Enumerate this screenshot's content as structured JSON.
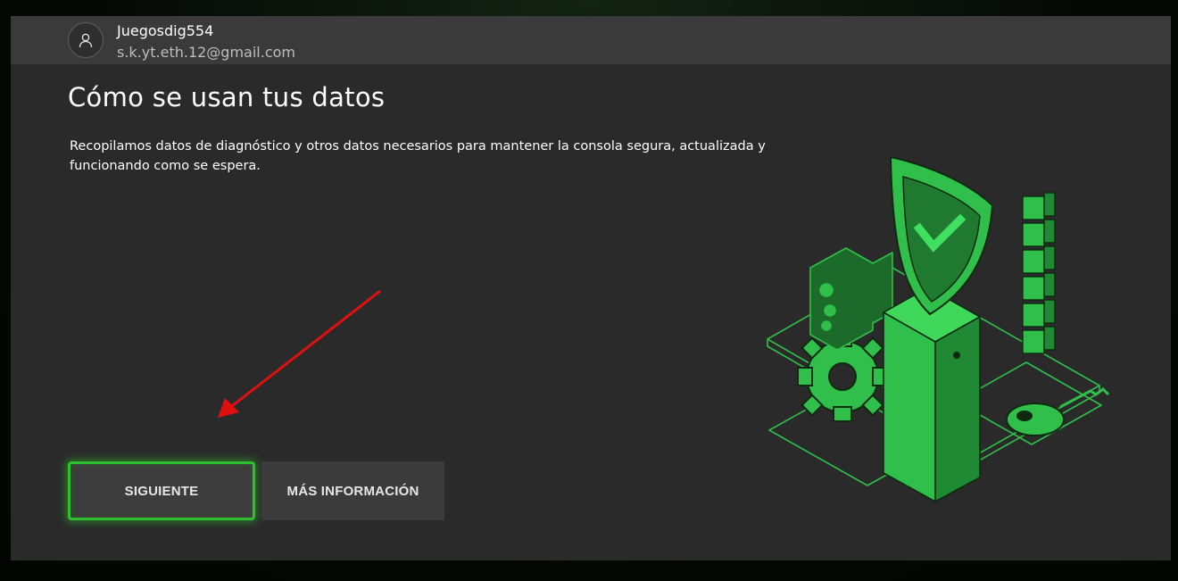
{
  "account": {
    "gamertag": "Juegosdig554",
    "email": "s.k.yt.eth.12@gmail.com",
    "avatar_icon": "person-icon"
  },
  "page": {
    "title": "Cómo se usan tus datos",
    "description": "Recopilamos datos de diagnóstico y otros datos necesarios para mantener la consola segura, actualizada y funcionando como se espera."
  },
  "buttons": {
    "next_label": "SIGUIENTE",
    "info_label": "MÁS INFORMACIÓN"
  },
  "colors": {
    "accent_green": "#2ec02e",
    "background": "#2a2a2a",
    "account_bar": "#3a3a3a",
    "annotation_arrow": "#e01010"
  },
  "illustration": {
    "icon": "security-shield-illustration"
  }
}
